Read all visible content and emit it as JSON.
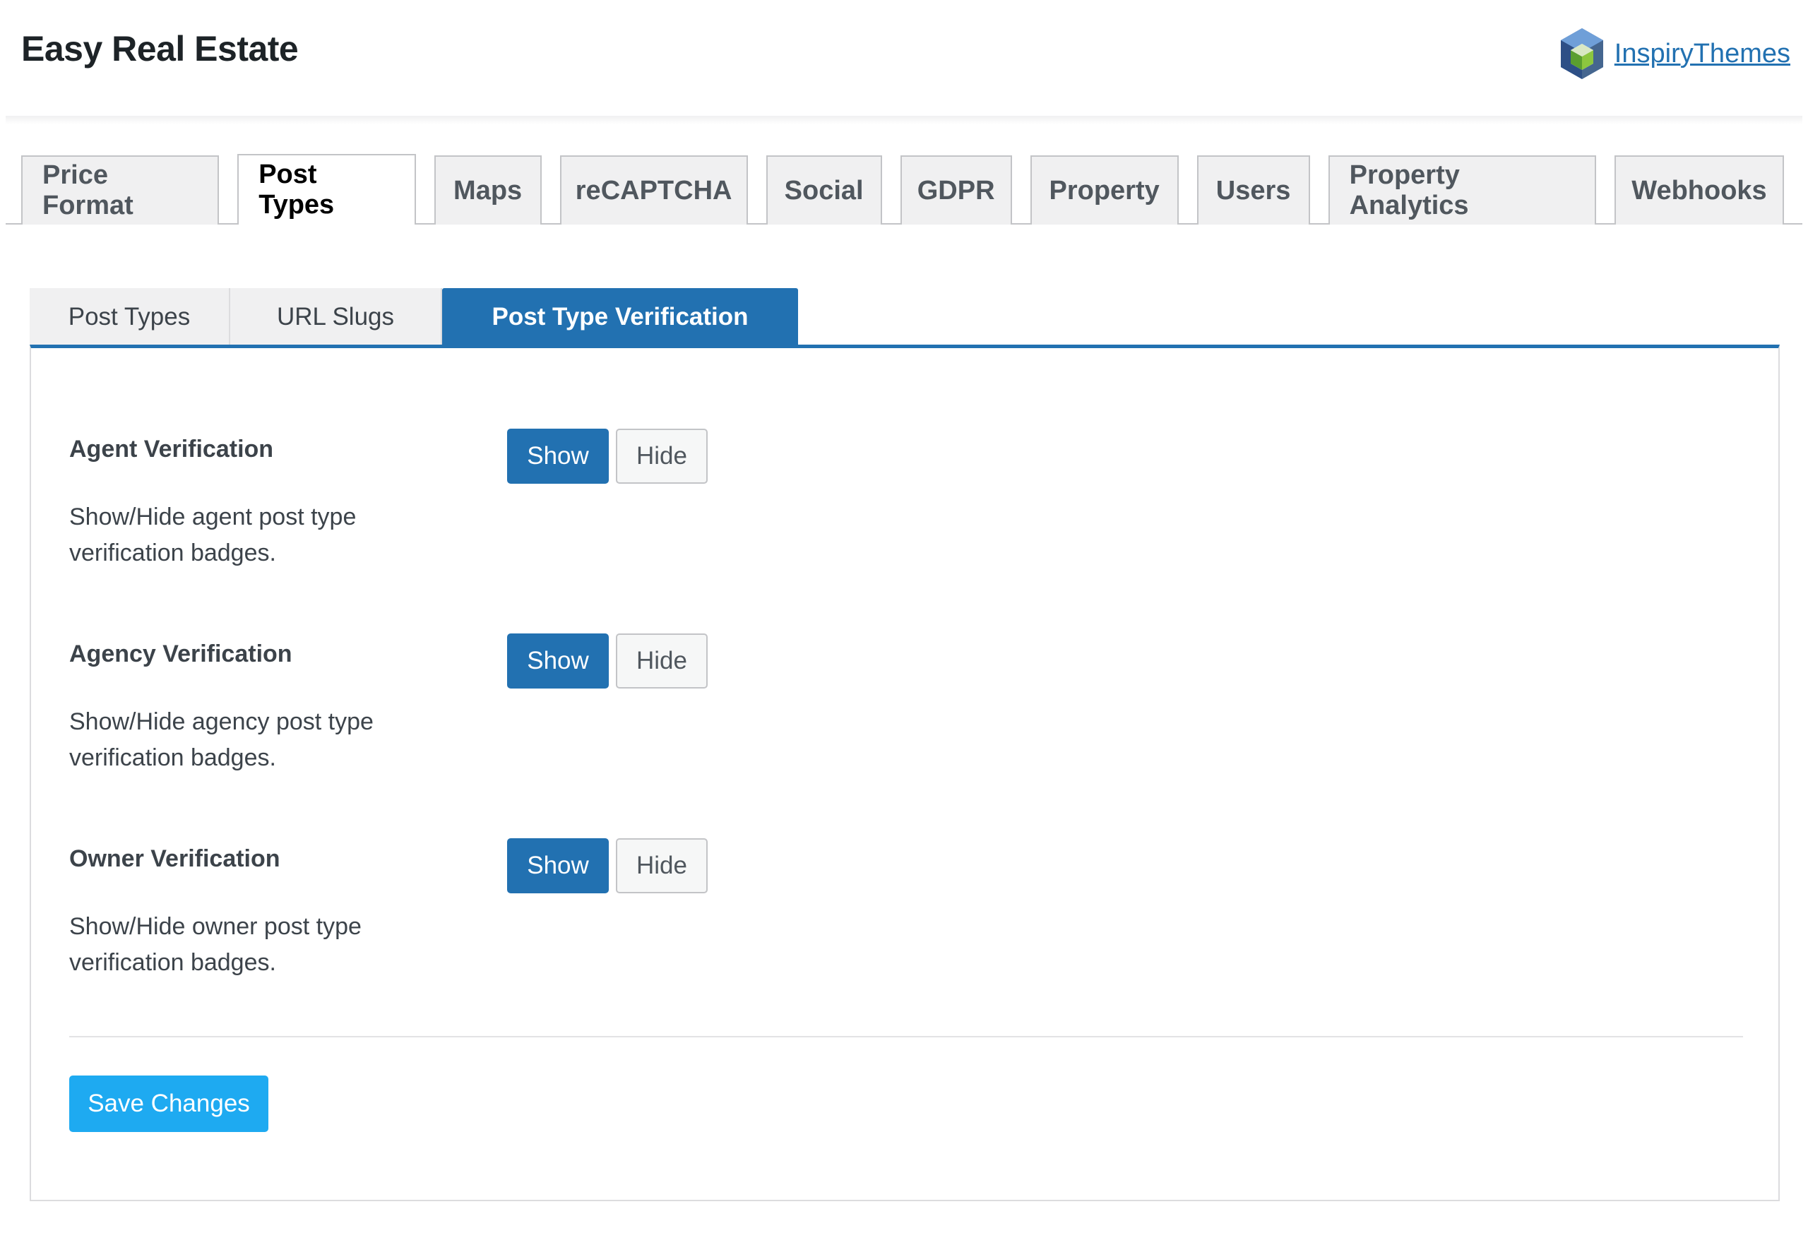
{
  "header": {
    "title": "Easy Real Estate",
    "brand_link": "InspiryThemes",
    "brand_icon": "inspirythemes-hexagon-icon"
  },
  "main_tabs": [
    {
      "label": "Price Format",
      "active": false
    },
    {
      "label": "Post Types",
      "active": true
    },
    {
      "label": "Maps",
      "active": false
    },
    {
      "label": "reCAPTCHA",
      "active": false
    },
    {
      "label": "Social",
      "active": false
    },
    {
      "label": "GDPR",
      "active": false
    },
    {
      "label": "Property",
      "active": false
    },
    {
      "label": "Users",
      "active": false
    },
    {
      "label": "Property Analytics",
      "active": false
    },
    {
      "label": "Webhooks",
      "active": false
    }
  ],
  "sub_tabs": [
    {
      "label": "Post Types",
      "active": false
    },
    {
      "label": "URL Slugs",
      "active": false
    },
    {
      "label": "Post Type Verification",
      "active": true
    }
  ],
  "settings": [
    {
      "label": "Agent Verification",
      "description": "Show/Hide agent post type verification badges.",
      "show_label": "Show",
      "hide_label": "Hide",
      "selected": "Show"
    },
    {
      "label": "Agency Verification",
      "description": "Show/Hide agency post type verification badges.",
      "show_label": "Show",
      "hide_label": "Hide",
      "selected": "Show"
    },
    {
      "label": "Owner Verification",
      "description": "Show/Hide owner post type verification badges.",
      "show_label": "Show",
      "hide_label": "Hide",
      "selected": "Show"
    }
  ],
  "save_label": "Save Changes",
  "colors": {
    "accent": "#2271b1",
    "save_button": "#1eaaf1",
    "link": "#2271b1"
  }
}
